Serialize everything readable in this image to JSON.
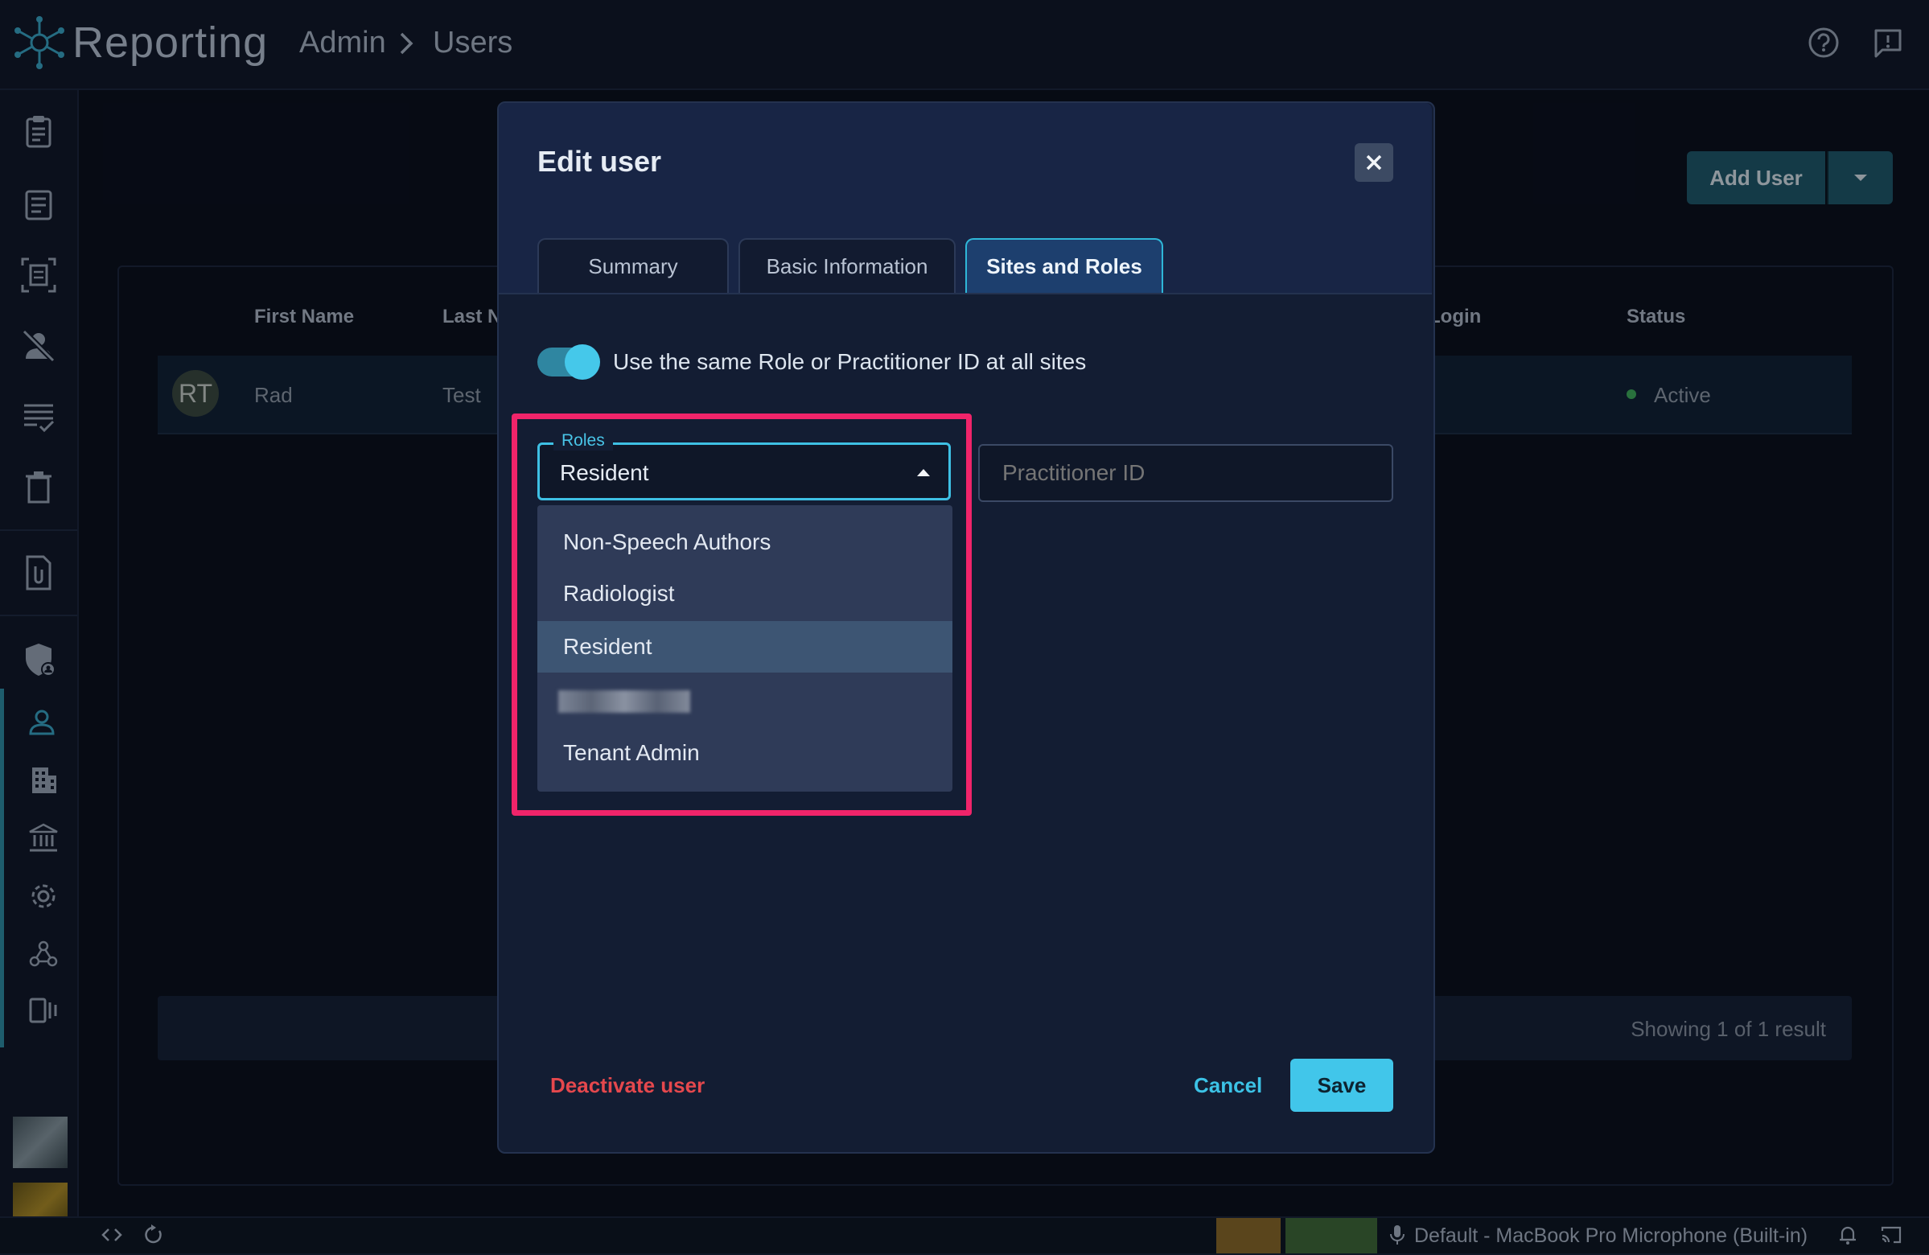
{
  "app": {
    "title": "Reporting",
    "breadcrumb": [
      "Admin",
      "Users"
    ]
  },
  "icons": {
    "logo": "network-logo-icon",
    "help": "help-circle-icon",
    "feedback": "feedback-icon",
    "rail": [
      "clipboard-icon",
      "document-icon",
      "scan-document-icon",
      "person-off-icon",
      "checklist-icon",
      "trash-icon",
      "attachment-icon",
      "security-shield-icon",
      "user-icon",
      "building-icon",
      "bank-icon",
      "gear-icon",
      "webhook-icon",
      "device-icon"
    ]
  },
  "page": {
    "add_user_label": "Add User",
    "table": {
      "headers": [
        "First Name",
        "Last N",
        "Login",
        "Status"
      ],
      "rows": [
        {
          "initials": "RT",
          "first": "Rad",
          "last": "Test",
          "status": "Active"
        }
      ]
    },
    "showing": "Showing 1 of 1 result"
  },
  "modal": {
    "title": "Edit user",
    "tabs": [
      "Summary",
      "Basic Information",
      "Sites and Roles"
    ],
    "active_tab": "Sites and Roles",
    "toggle_label": "Use the same Role or Practitioner ID at all sites",
    "toggle_on": true,
    "roles": {
      "label": "Roles",
      "value": "Resident",
      "options": [
        "Non-Speech Authors",
        "Radiologist",
        "Resident",
        "",
        "Tenant Admin"
      ],
      "selected_index": 2
    },
    "practitioner_placeholder": "Practitioner ID",
    "deactivate_label": "Deactivate user",
    "cancel_label": "Cancel",
    "save_label": "Save"
  },
  "statusbar": {
    "mic": "Default - MacBook Pro Microphone (Built-in)"
  },
  "colors": {
    "accent": "#41c6ea",
    "highlight": "#f0246a",
    "danger": "#e5484d",
    "success": "#3fae5f"
  }
}
